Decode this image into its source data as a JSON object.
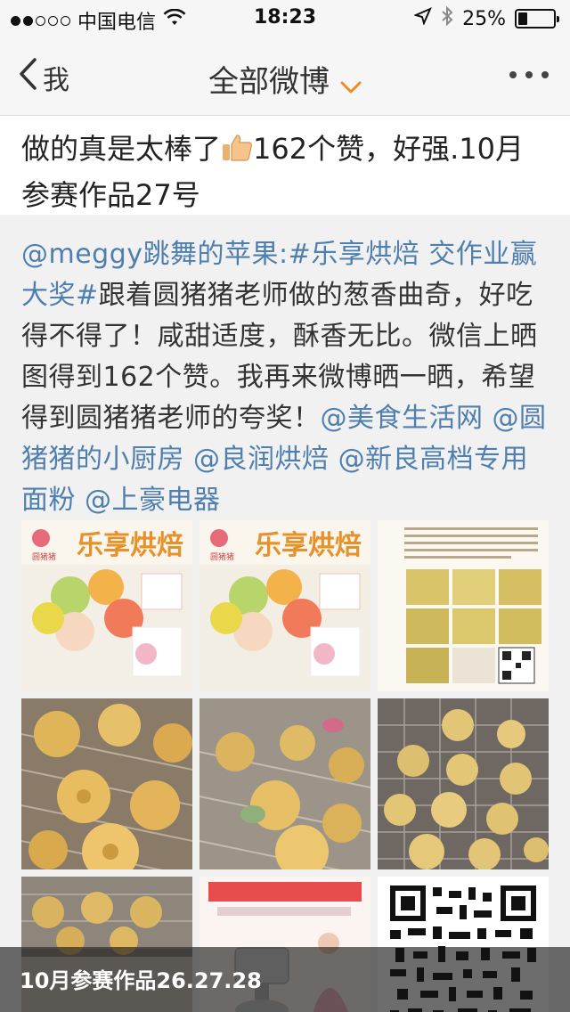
{
  "status_bar": {
    "carrier": "中国电信",
    "time": "18:23",
    "battery": "25%",
    "battery_level": 0.25,
    "signal_filled": 2,
    "signal_total": 5
  },
  "nav": {
    "back_label": "我",
    "title": "全部微博"
  },
  "repost_comment": {
    "before_emoji": "做的真是太棒了",
    "after_emoji_line1": "162个赞，好强.10月",
    "line2": "参赛作品27号"
  },
  "original_post": {
    "segments": [
      {
        "text": "@meggy跳舞的苹果:#乐享烘焙 交作业赢大奖#",
        "link": true
      },
      {
        "text": "跟着圆猪猪老师做的葱香曲奇，好吃得不得了！咸甜适度，酥香无比。微信上晒图得到162个赞。我再来微博晒一晒，希望得到圆猪猪老师的夸奖！",
        "link": false
      },
      {
        "text": "@美食生活网 @圆猪猪的小厨房 @良润烘焙 @新良高档专用面粉 @上豪电器",
        "link": true
      }
    ],
    "images": [
      {
        "name": "book-cover-image-1",
        "cover_title": "乐享烘焙",
        "author_tag": "圆猪猪"
      },
      {
        "name": "book-cover-image-2",
        "cover_title": "乐享烘焙",
        "author_tag": "圆猪猪"
      },
      {
        "name": "book-page-collage-image"
      },
      {
        "name": "cookies-closeup-image-1"
      },
      {
        "name": "cookies-closeup-image-2"
      },
      {
        "name": "cookies-rack-image"
      },
      {
        "name": "cookies-tray-image"
      },
      {
        "name": "mixer-ad-image"
      },
      {
        "name": "qr-code-image"
      }
    ],
    "caption": "10月参赛作品26.27.28"
  },
  "colors": {
    "link": "#4f7fae",
    "accent_orange": "#f08a24"
  }
}
